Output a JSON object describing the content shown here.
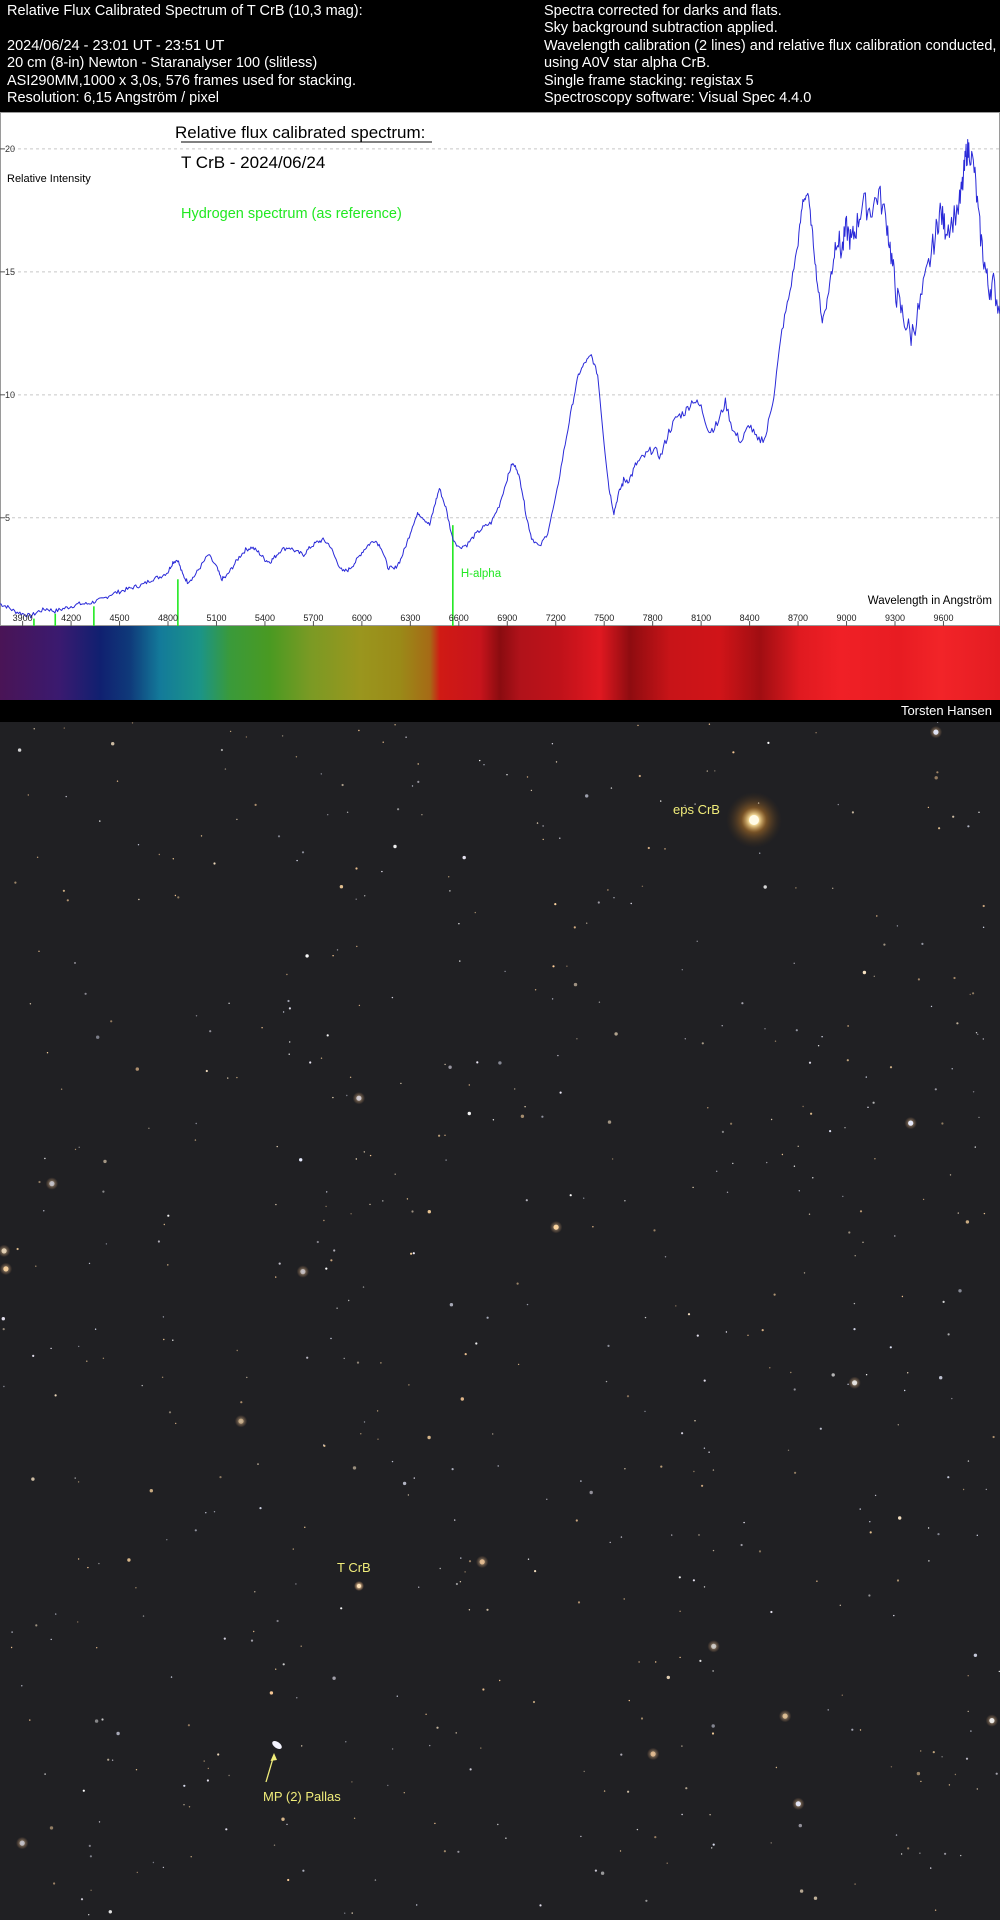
{
  "header": {
    "left": [
      "Relative Flux Calibrated Spectrum of T CrB (10,3 mag):",
      "",
      "2024/06/24 - 23:01 UT - 23:51 UT",
      "20 cm (8-in) Newton - Staranalyser 100 (slitless)",
      "ASI290MM,1000 x 3,0s, 576 frames used for stacking.",
      "Resolution: 6,15 Angström / pixel"
    ],
    "right": [
      "Spectra corrected for darks and flats.",
      "Sky background subtraction applied.",
      "Wavelength calibration (2 lines) and relative flux calibration conducted,",
      "using A0V star alpha CrB.",
      "Single frame stacking: registax 5",
      "Spectroscopy software: Visual Spec 4.4.0"
    ]
  },
  "chart_data": {
    "type": "line",
    "title": "Relative flux calibrated spectrum:",
    "subtitle": "T CrB - 2024/06/24",
    "xlabel": "Wavelength in Angström",
    "ylabel": "Relative Intensity",
    "xlim": [
      3760,
      9950
    ],
    "ylim": [
      0.6,
      21.5
    ],
    "x_ticks": [
      3900,
      4200,
      4500,
      4800,
      5100,
      5400,
      5700,
      6000,
      6300,
      6600,
      6900,
      7200,
      7500,
      7800,
      8100,
      8400,
      8700,
      9000,
      9300,
      9600
    ],
    "y_ticks": [
      5,
      10,
      15,
      20
    ],
    "grid": "horizontal dashed",
    "series": [
      {
        "color": "#2a2ad8",
        "x": [
          3760,
          3800,
          3850,
          3900,
          3950,
          4000,
          4050,
          4100,
          4150,
          4200,
          4250,
          4300,
          4350,
          4400,
          4450,
          4500,
          4550,
          4600,
          4650,
          4700,
          4750,
          4800,
          4830,
          4860,
          4890,
          4920,
          4960,
          5000,
          5050,
          5100,
          5130,
          5160,
          5200,
          5240,
          5280,
          5320,
          5360,
          5400,
          5430,
          5460,
          5500,
          5550,
          5600,
          5640,
          5680,
          5720,
          5760,
          5800,
          5840,
          5880,
          5920,
          5960,
          6000,
          6040,
          6080,
          6120,
          6160,
          6200,
          6240,
          6280,
          6320,
          6350,
          6380,
          6420,
          6450,
          6480,
          6520,
          6560,
          6600,
          6650,
          6700,
          6750,
          6800,
          6850,
          6900,
          6930,
          6960,
          6990,
          7020,
          7050,
          7100,
          7150,
          7200,
          7250,
          7300,
          7340,
          7380,
          7420,
          7460,
          7500,
          7530,
          7560,
          7590,
          7620,
          7660,
          7700,
          7750,
          7800,
          7850,
          7900,
          7950,
          8000,
          8050,
          8100,
          8150,
          8200,
          8250,
          8300,
          8350,
          8400,
          8450,
          8500,
          8550,
          8600,
          8650,
          8700,
          8730,
          8760,
          8790,
          8820,
          8850,
          8880,
          8910,
          8940,
          8970,
          9000,
          9030,
          9060,
          9100,
          9150,
          9200,
          9250,
          9280,
          9310,
          9350,
          9400,
          9450,
          9500,
          9550,
          9580,
          9610,
          9650,
          9700,
          9720,
          9740,
          9760,
          9790,
          9820,
          9850,
          9880,
          9910,
          9950
        ],
        "y": [
          1.5,
          1.4,
          1.2,
          1.1,
          1.0,
          1.2,
          1.3,
          1.2,
          1.3,
          1.4,
          1.5,
          1.5,
          1.6,
          1.7,
          1.9,
          2.0,
          2.1,
          2.2,
          2.3,
          2.5,
          2.6,
          2.8,
          3.2,
          3.3,
          2.7,
          2.4,
          2.6,
          3.0,
          3.5,
          3.0,
          2.5,
          2.6,
          3.0,
          3.4,
          3.7,
          3.8,
          3.6,
          3.3,
          3.2,
          3.4,
          3.7,
          3.8,
          3.6,
          3.5,
          3.8,
          4.0,
          4.1,
          3.9,
          3.3,
          2.8,
          2.9,
          3.2,
          3.6,
          3.9,
          4.1,
          3.8,
          3.0,
          2.9,
          3.3,
          4.0,
          4.8,
          5.2,
          5.0,
          4.7,
          5.5,
          6.2,
          5.4,
          4.2,
          3.8,
          3.9,
          4.3,
          4.6,
          4.8,
          5.5,
          6.6,
          7.2,
          7.0,
          6.2,
          5.0,
          4.2,
          3.8,
          4.4,
          5.8,
          7.7,
          9.5,
          10.8,
          11.3,
          11.6,
          10.8,
          8.0,
          6.2,
          5.2,
          6.0,
          6.5,
          6.6,
          7.2,
          7.5,
          7.8,
          7.5,
          8.5,
          9.1,
          9.3,
          9.8,
          9.5,
          8.5,
          8.8,
          9.7,
          8.5,
          8.1,
          8.8,
          8.1,
          8.3,
          10.0,
          12.6,
          14.2,
          16.2,
          17.9,
          18.2,
          16.5,
          14.5,
          13.0,
          13.8,
          15.2,
          16.5,
          15.8,
          16.8,
          16.2,
          16.8,
          17.8,
          17.5,
          18.2,
          17.0,
          15.5,
          14.0,
          13.2,
          12.4,
          13.5,
          15.0,
          16.5,
          17.5,
          16.8,
          17.0,
          17.8,
          18.6,
          19.8,
          20.0,
          19.2,
          17.0,
          15.5,
          14.3,
          14.5,
          13.3
        ]
      }
    ],
    "reference": {
      "name": "Hydrogen spectrum (as reference)",
      "color": "#22e822",
      "lines": [
        {
          "x": 3970,
          "y": 0.9
        },
        {
          "x": 4102,
          "y": 1.1
        },
        {
          "x": 4341,
          "y": 1.4
        },
        {
          "x": 4861,
          "y": 2.5
        },
        {
          "x": 6563,
          "y": 4.7,
          "label": "H-alpha"
        }
      ]
    }
  },
  "spectrum_strip": {
    "stops": [
      {
        "at": 0.0,
        "color": "#4a1456"
      },
      {
        "at": 0.06,
        "color": "#3a1a70"
      },
      {
        "at": 0.1,
        "color": "#102070"
      },
      {
        "at": 0.13,
        "color": "#0f3a7a"
      },
      {
        "at": 0.16,
        "color": "#137a9a"
      },
      {
        "at": 0.2,
        "color": "#1b9488"
      },
      {
        "at": 0.23,
        "color": "#3a9a3a"
      },
      {
        "at": 0.27,
        "color": "#4a9a22"
      },
      {
        "at": 0.31,
        "color": "#7a9a24"
      },
      {
        "at": 0.36,
        "color": "#9a961e"
      },
      {
        "at": 0.4,
        "color": "#9a8a18"
      },
      {
        "at": 0.43,
        "color": "#a66a16"
      },
      {
        "at": 0.44,
        "color": "#d01a14"
      },
      {
        "at": 0.48,
        "color": "#c8141c"
      },
      {
        "at": 0.5,
        "color": "#8a0c10"
      },
      {
        "at": 0.52,
        "color": "#b0121a"
      },
      {
        "at": 0.56,
        "color": "#c0121a"
      },
      {
        "at": 0.6,
        "color": "#e01820"
      },
      {
        "at": 0.63,
        "color": "#8e0c10"
      },
      {
        "at": 0.67,
        "color": "#c81418"
      },
      {
        "at": 0.72,
        "color": "#d01418"
      },
      {
        "at": 0.76,
        "color": "#a00e12"
      },
      {
        "at": 0.8,
        "color": "#e01a20"
      },
      {
        "at": 0.84,
        "color": "#f02026"
      },
      {
        "at": 0.9,
        "color": "#e81c22"
      },
      {
        "at": 0.94,
        "color": "#f22428"
      },
      {
        "at": 1.0,
        "color": "#e41c22"
      }
    ]
  },
  "credit": "Torsten Hansen",
  "sky_field": {
    "labels": {
      "eps_crb": "eps CrB",
      "t_crb": "T CrB",
      "pallas": "MP (2) Pallas"
    },
    "label_color": "#f0ec7a"
  }
}
